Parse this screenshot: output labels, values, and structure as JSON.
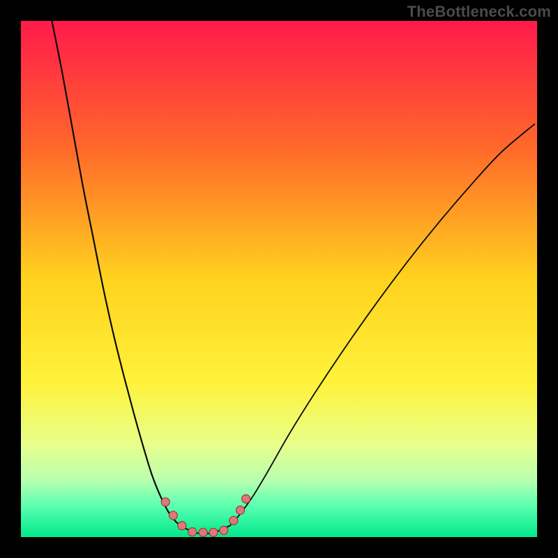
{
  "watermark": "TheBottleneck.com",
  "chart_data": {
    "type": "line",
    "title": "",
    "xlabel": "",
    "ylabel": "",
    "xlim": [
      0,
      100
    ],
    "ylim": [
      0,
      100
    ],
    "gradient_stops": [
      {
        "offset": 0,
        "color": "#ff1a4b"
      },
      {
        "offset": 25,
        "color": "#ff6a2a"
      },
      {
        "offset": 50,
        "color": "#ffd21e"
      },
      {
        "offset": 70,
        "color": "#fff23a"
      },
      {
        "offset": 82,
        "color": "#e8ff8a"
      },
      {
        "offset": 89,
        "color": "#b8ffb0"
      },
      {
        "offset": 94,
        "color": "#5bffb0"
      },
      {
        "offset": 100,
        "color": "#00e88b"
      }
    ],
    "series": [
      {
        "name": "left-curve",
        "x": [
          6,
          8,
          10,
          12,
          14,
          16,
          18,
          20,
          22,
          24,
          25.4,
          27,
          28.5,
          30,
          31.2
        ],
        "y": [
          100,
          90,
          79,
          68,
          58,
          48,
          39,
          31,
          23.5,
          16.5,
          12,
          8,
          5,
          3,
          2
        ],
        "stroke": "#0a0a0a",
        "width": 2.2
      },
      {
        "name": "right-curve",
        "x": [
          40.5,
          42.5,
          45,
          48,
          52,
          57,
          63,
          69,
          75,
          81,
          87,
          93,
          99.5
        ],
        "y": [
          2.2,
          4.5,
          8,
          13,
          20,
          28,
          37,
          45.5,
          53.5,
          61,
          68,
          74.5,
          80
        ],
        "stroke": "#0a0a0a",
        "width": 1.8
      },
      {
        "name": "flat-segment",
        "x": [
          31.2,
          34,
          37,
          40.5
        ],
        "y": [
          2,
          0.8,
          0.8,
          2.2
        ],
        "stroke": "#0a0a0a",
        "width": 2.0
      }
    ],
    "markers": [
      {
        "x": 28.0,
        "y": 6.8,
        "r": 6
      },
      {
        "x": 29.5,
        "y": 4.2,
        "r": 6
      },
      {
        "x": 31.2,
        "y": 2.2,
        "r": 6
      },
      {
        "x": 33.2,
        "y": 1.0,
        "r": 6
      },
      {
        "x": 35.3,
        "y": 0.9,
        "r": 6
      },
      {
        "x": 37.3,
        "y": 0.9,
        "r": 6
      },
      {
        "x": 39.3,
        "y": 1.3,
        "r": 6
      },
      {
        "x": 41.2,
        "y": 3.2,
        "r": 6
      },
      {
        "x": 42.5,
        "y": 5.2,
        "r": 6
      },
      {
        "x": 43.6,
        "y": 7.4,
        "r": 6
      }
    ],
    "marker_style": {
      "fill": "#e07878",
      "stroke": "#9a3a3a",
      "stroke_width": 1.2
    }
  }
}
